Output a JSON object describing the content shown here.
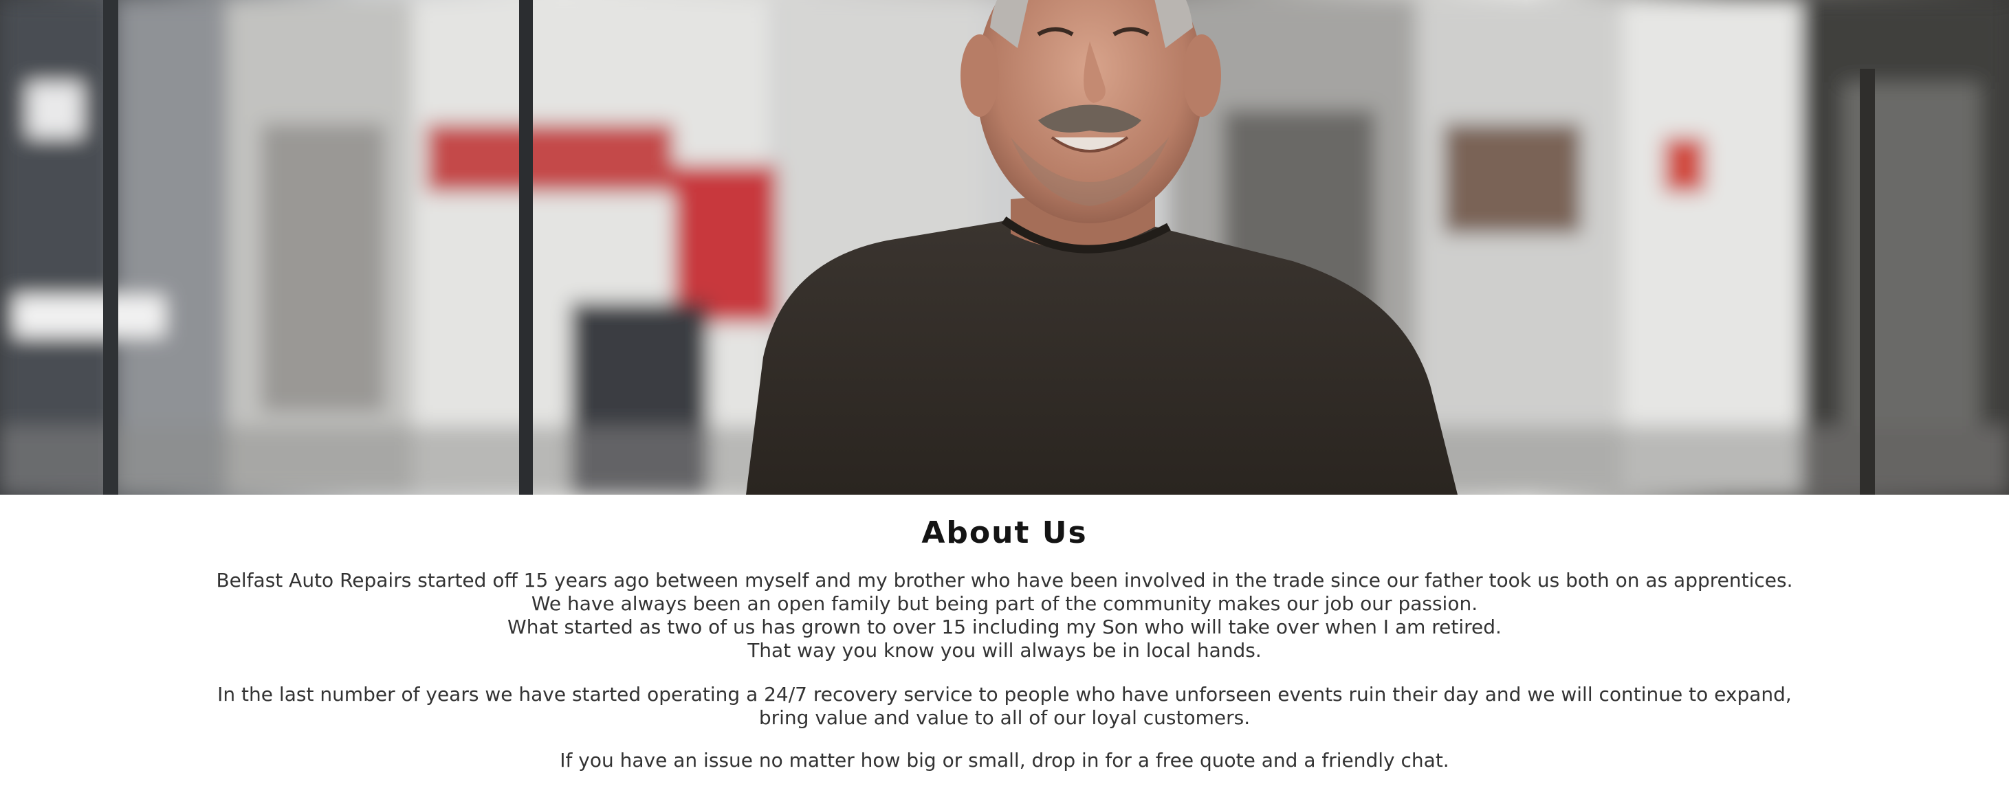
{
  "hero": {
    "image_alt": "Smiling mechanic in a dark t-shirt standing in a repair workshop"
  },
  "about": {
    "title": "About Us",
    "paragraph1": [
      "Belfast Auto Repairs started off 15 years ago between myself and my brother who have been involved in the trade since our father took us both on as apprentices.",
      "We have always been an open family but being part of the community makes our job our passion.",
      "What started as two of us has grown to over 15 including my Son who will take over when I am retired.",
      "That way you know you will always be in local hands."
    ],
    "paragraph2": [
      "In the last number of years we have started operating a 24/7 recovery service to people who have unforseen events ruin their day and we will continue to expand,",
      "bring value and value to all of our loyal customers."
    ],
    "paragraph3": [
      "If you have an issue no matter how big or small, drop in for a free quote and a friendly chat."
    ]
  }
}
